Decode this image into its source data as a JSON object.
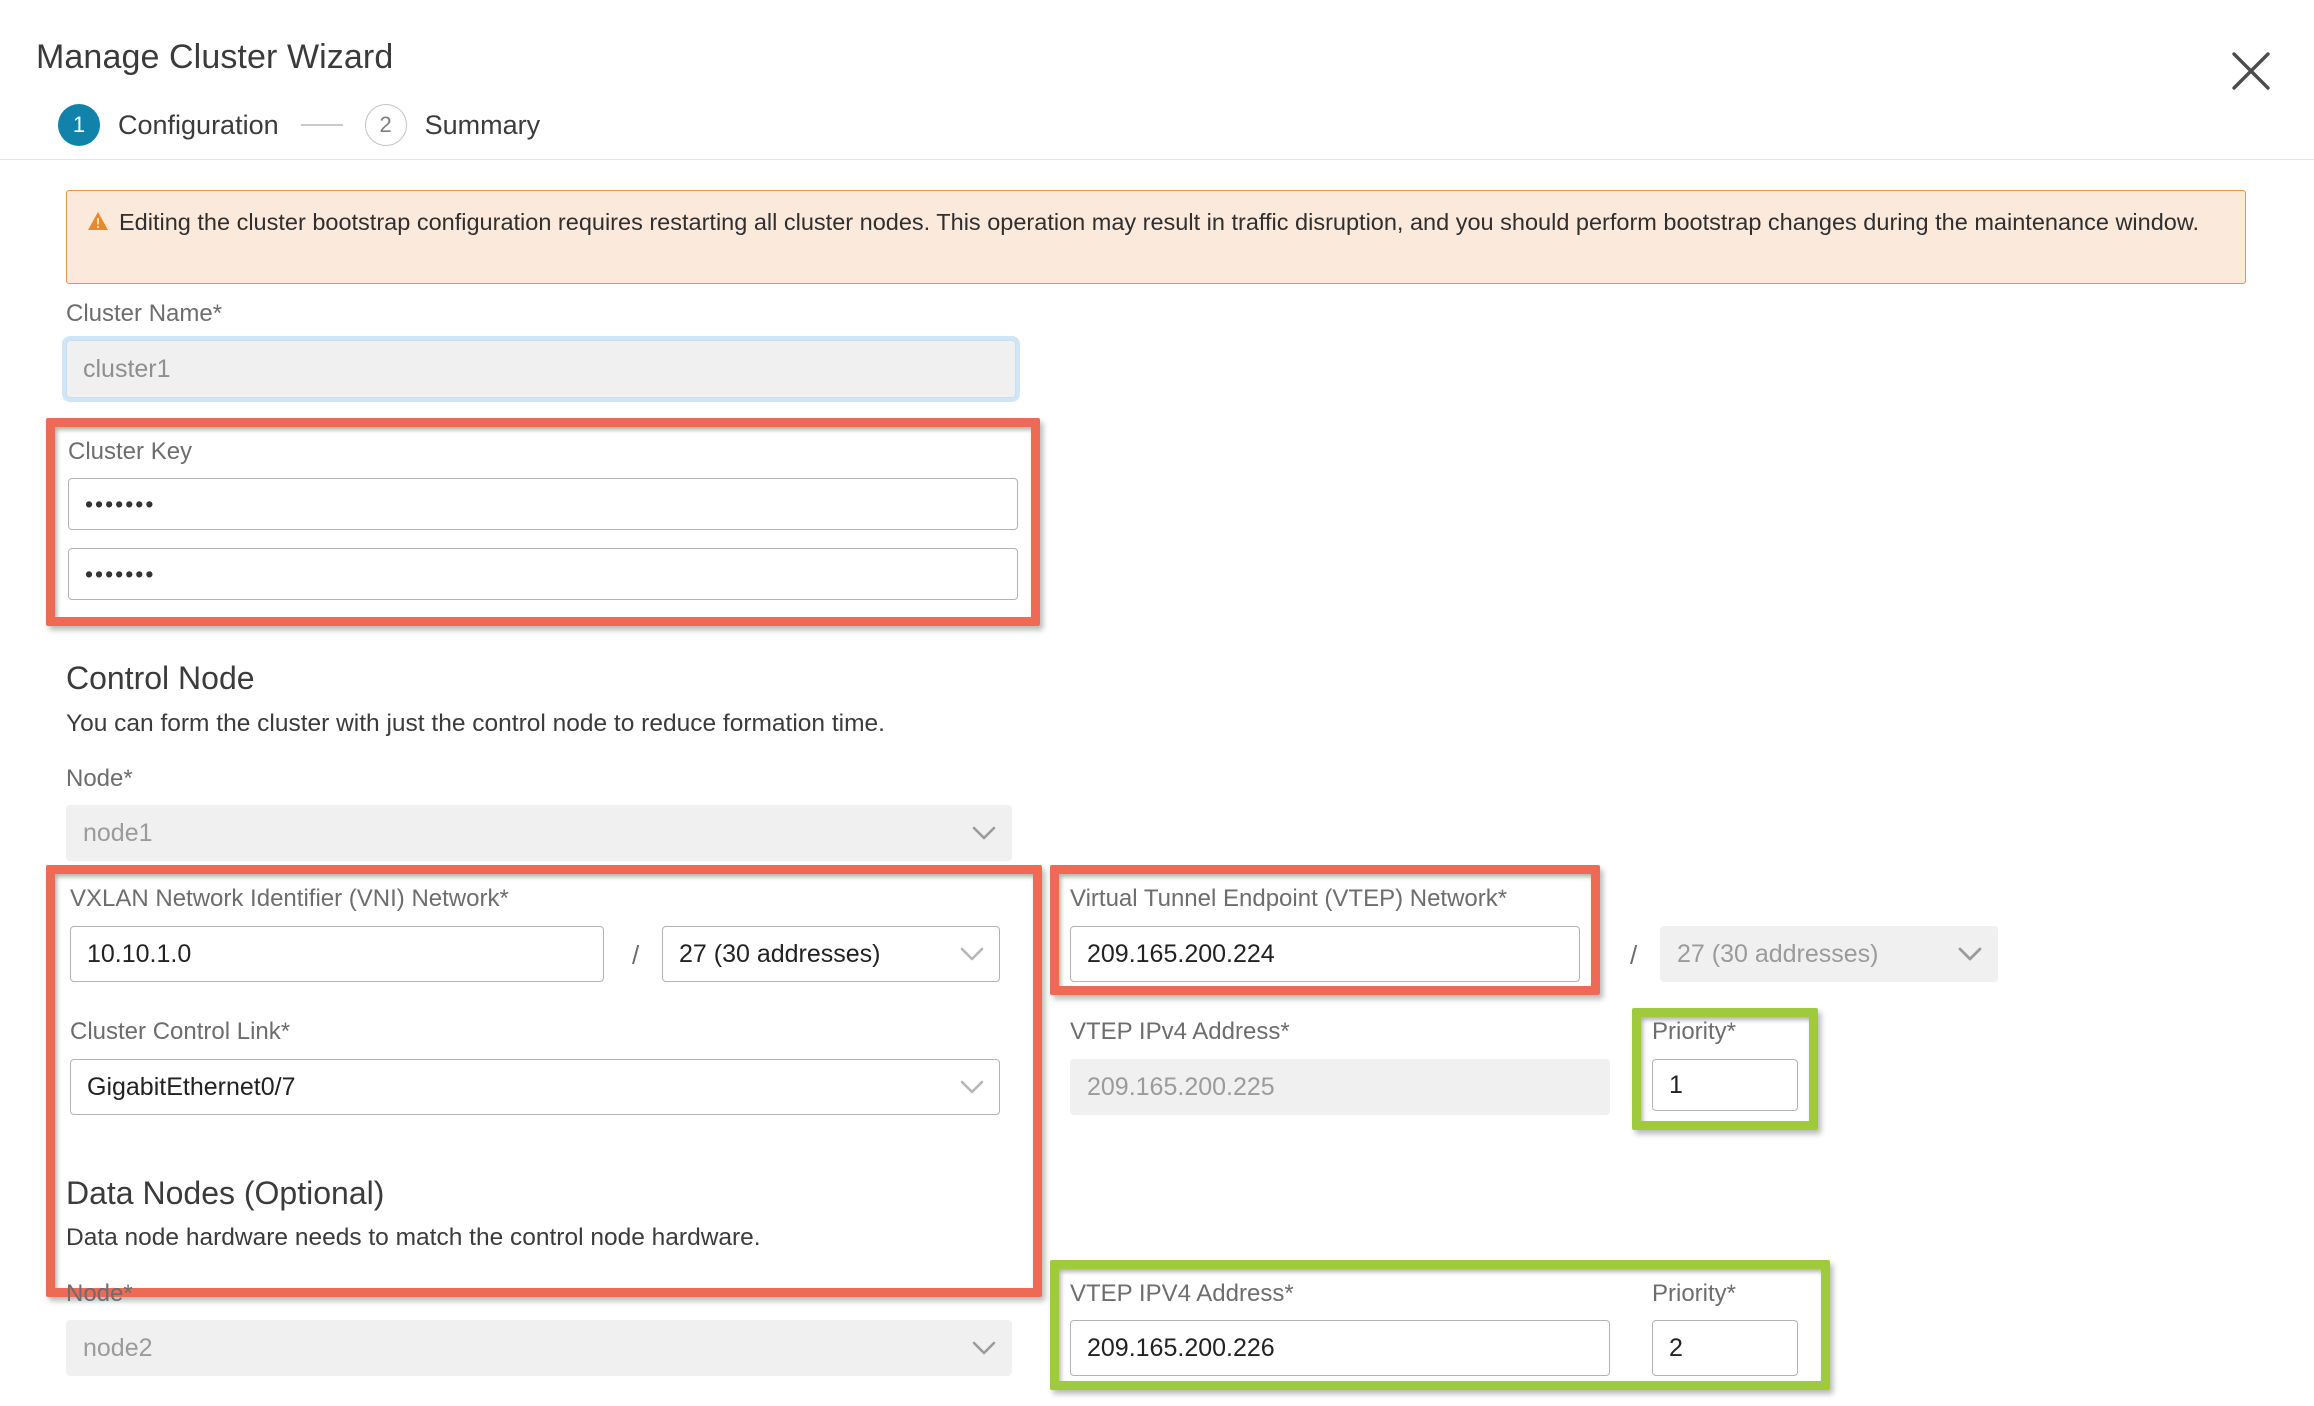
{
  "header": {
    "title": "Manage Cluster Wizard",
    "close_icon": "close-icon",
    "steps": [
      {
        "number": "1",
        "label": "Configuration",
        "state": "active"
      },
      {
        "number": "2",
        "label": "Summary",
        "state": "inactive"
      }
    ]
  },
  "alert": {
    "icon": "warning-triangle-icon",
    "text": "Editing the cluster bootstrap configuration requires restarting all cluster nodes. This operation may result in traffic disruption, and you should perform bootstrap changes during the maintenance window."
  },
  "cluster_name": {
    "label": "Cluster Name*",
    "value": "cluster1"
  },
  "cluster_key": {
    "label": "Cluster Key",
    "value_1": "•••••••",
    "value_2": "•••••••"
  },
  "control_node": {
    "title": "Control Node",
    "subtitle": "You can form the cluster with just the control node to reduce formation time.",
    "node": {
      "label": "Node*",
      "value": "node1"
    },
    "vni": {
      "label": "VXLAN Network Identifier (VNI) Network*",
      "address": "10.10.1.0",
      "separator": "/",
      "prefix": "27 (30 addresses)"
    },
    "ccl": {
      "label": "Cluster Control Link*",
      "value": "GigabitEthernet0/7"
    },
    "vtep_network": {
      "label": "Virtual Tunnel Endpoint (VTEP) Network*",
      "address": "209.165.200.224",
      "separator": "/",
      "prefix": "27 (30 addresses)"
    },
    "vtep_ipv4": {
      "label": "VTEP IPv4 Address*",
      "value": "209.165.200.225"
    },
    "priority": {
      "label": "Priority*",
      "value": "1"
    }
  },
  "data_nodes": {
    "title": "Data Nodes (Optional)",
    "subtitle": "Data node hardware needs to match the control node hardware.",
    "node": {
      "label": "Node*",
      "value": "node2"
    },
    "vtep_ipv4": {
      "label": "VTEP IPV4 Address*",
      "value": "209.165.200.226"
    },
    "priority": {
      "label": "Priority*",
      "value": "2"
    }
  },
  "colors": {
    "highlight_red": "#ed6a55",
    "highlight_green": "#9fca3c",
    "step_active": "#1183ab",
    "alert_bg": "#fbe9dc",
    "alert_border": "#e69544"
  }
}
